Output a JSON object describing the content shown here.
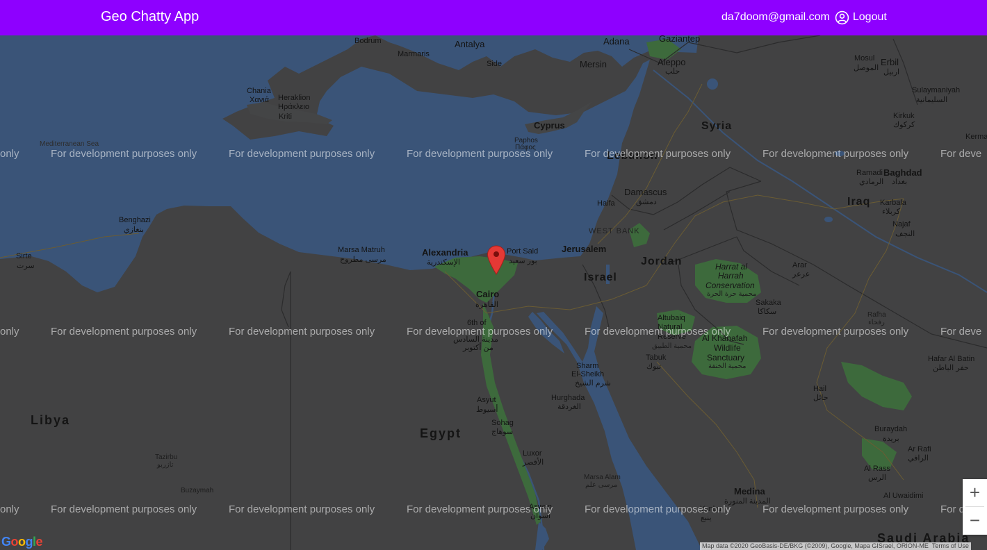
{
  "app": {
    "title": "Geo Chatty App",
    "user_email": "da7doom@gmail.com",
    "logout_label": "Logout"
  },
  "map": {
    "countries": [
      "Libya",
      "Egypt",
      "Syria",
      "Iraq",
      "Jordan",
      "Israel",
      "Lebanon",
      "Saudi Arabia"
    ],
    "regions": [
      "WEST BANK"
    ],
    "sea": "Mediterranean Sea",
    "cities": [
      "Bodrum",
      "Marmaris",
      "Antalya",
      "Side",
      "Adana",
      "Mersin",
      "Gaziantep",
      "Aleppo",
      "حلب",
      "Mosul",
      "الموصل",
      "Erbil",
      "اربيل",
      "Sulaymaniyah",
      "السليمانية",
      "Kirkuk",
      "كركوك",
      "Chania",
      "Χανιά",
      "Heraklion",
      "Ηράκλειο",
      "Kriti",
      "Cyprus",
      "Paphos",
      "Πάφος",
      "Damascus",
      "دمشق",
      "Haifa",
      "Baghdad",
      "بغداد",
      "Ramadi",
      "الرمادي",
      "Karbala",
      "كربلاء",
      "Najaf",
      "النجف",
      "Kerma",
      "Benghazi",
      "بنغازي",
      "Sirte",
      "سرت",
      "Marsa Matruh",
      "مرسى مطروح",
      "Alexandria",
      "الإسكندرية",
      "Port Said",
      "بور سعيد",
      "Cairo",
      "القاهرة",
      "6th of",
      "مدينة السادس",
      "من أكتوبر",
      "Jerusalem",
      "Arar",
      "عرعر",
      "Sakaka",
      "سكاكا",
      "Rafha",
      "رفحاء",
      "Altubaiq",
      "Natural",
      "Reserve",
      "محمية الطبيق",
      "Tabuk",
      "تبوك",
      "Sharm",
      "El-Sheikh",
      "شرم الشيخ",
      "Hurghada",
      "الغردقة",
      "Hafar Al Batin",
      "حفر الباطن",
      "Hail",
      "حائل",
      "Asyut",
      "أسيوط",
      "Sohag",
      "سوهاج",
      "Luxor",
      "الأقصر",
      "Aswan",
      "أسوان",
      "Marsa Alam",
      "مرسى علم",
      "Tazirbu",
      "تازربو",
      "Buzaymah",
      "Buraydah",
      "بريدة",
      "Al Rass",
      "الرس",
      "Al Uwaidimi",
      "Medina",
      "المدينة المنورة",
      "Yanbu",
      "ينبع",
      "Ar Rafi",
      "الرافي"
    ],
    "parks": [
      "Harrat al",
      "Harrah",
      "Conservation",
      "محمية حرة الحرة",
      "Al Khanafah",
      "Wildlife",
      "Sanctuary",
      "محمية الخنفة"
    ],
    "dev_watermark": "For development purposes only",
    "edge_fragment_left": "only",
    "edge_fragment_right": "For deve",
    "zoom_in_label": "+",
    "zoom_out_label": "−",
    "google_logo": "Google",
    "attribution": "Map data ©2020 GeoBasis-DE/BKG (©2009), Google, Mapa GISrael, ORION-ME",
    "terms": "Terms of Use",
    "colors": {
      "header": "#8e00ff",
      "land": "#424243",
      "water": "#3a5478",
      "green_area": "#3d6a3c",
      "marker": "#e53935"
    }
  }
}
